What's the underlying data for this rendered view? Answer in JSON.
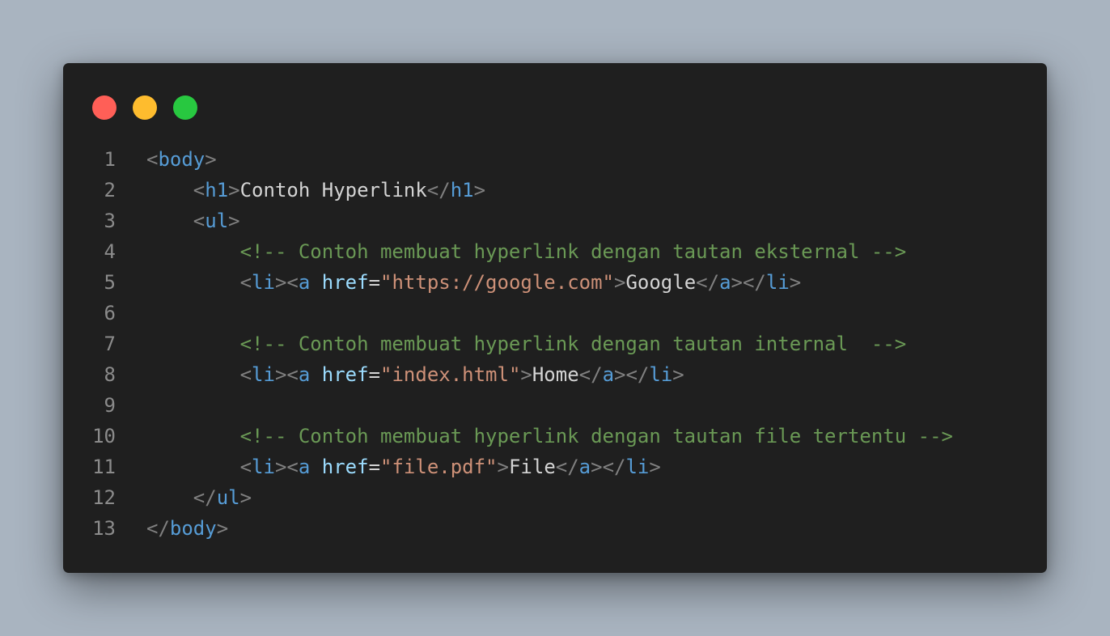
{
  "window": {
    "controls": [
      {
        "name": "close-button",
        "color": "#ff5f57"
      },
      {
        "name": "minimize-button",
        "color": "#febc2e"
      },
      {
        "name": "maximize-button",
        "color": "#28c840"
      }
    ]
  },
  "code": {
    "language": "html",
    "lines": [
      {
        "number": "1",
        "indent": 0,
        "tokens": [
          {
            "t": "punct",
            "v": "<"
          },
          {
            "t": "tag",
            "v": "body"
          },
          {
            "t": "punct",
            "v": ">"
          }
        ]
      },
      {
        "number": "2",
        "indent": 4,
        "tokens": [
          {
            "t": "punct",
            "v": "<"
          },
          {
            "t": "tag",
            "v": "h1"
          },
          {
            "t": "punct",
            "v": ">"
          },
          {
            "t": "text",
            "v": "Contoh Hyperlink"
          },
          {
            "t": "punct",
            "v": "</"
          },
          {
            "t": "tag",
            "v": "h1"
          },
          {
            "t": "punct",
            "v": ">"
          }
        ]
      },
      {
        "number": "3",
        "indent": 4,
        "tokens": [
          {
            "t": "punct",
            "v": "<"
          },
          {
            "t": "tag",
            "v": "ul"
          },
          {
            "t": "punct",
            "v": ">"
          }
        ]
      },
      {
        "number": "4",
        "indent": 8,
        "tokens": [
          {
            "t": "comment",
            "v": "<!-- Contoh membuat hyperlink dengan tautan eksternal -->"
          }
        ]
      },
      {
        "number": "5",
        "indent": 8,
        "tokens": [
          {
            "t": "punct",
            "v": "<"
          },
          {
            "t": "tag",
            "v": "li"
          },
          {
            "t": "punct",
            "v": ">"
          },
          {
            "t": "punct",
            "v": "<"
          },
          {
            "t": "tag",
            "v": "a"
          },
          {
            "t": "text",
            "v": " "
          },
          {
            "t": "attr",
            "v": "href"
          },
          {
            "t": "eq",
            "v": "="
          },
          {
            "t": "str",
            "v": "\"https://google.com\""
          },
          {
            "t": "punct",
            "v": ">"
          },
          {
            "t": "text",
            "v": "Google"
          },
          {
            "t": "punct",
            "v": "</"
          },
          {
            "t": "tag",
            "v": "a"
          },
          {
            "t": "punct",
            "v": ">"
          },
          {
            "t": "punct",
            "v": "</"
          },
          {
            "t": "tag",
            "v": "li"
          },
          {
            "t": "punct",
            "v": ">"
          }
        ]
      },
      {
        "number": "6",
        "indent": 0,
        "tokens": []
      },
      {
        "number": "7",
        "indent": 8,
        "tokens": [
          {
            "t": "comment",
            "v": "<!-- Contoh membuat hyperlink dengan tautan internal  -->"
          }
        ]
      },
      {
        "number": "8",
        "indent": 8,
        "tokens": [
          {
            "t": "punct",
            "v": "<"
          },
          {
            "t": "tag",
            "v": "li"
          },
          {
            "t": "punct",
            "v": ">"
          },
          {
            "t": "punct",
            "v": "<"
          },
          {
            "t": "tag",
            "v": "a"
          },
          {
            "t": "text",
            "v": " "
          },
          {
            "t": "attr",
            "v": "href"
          },
          {
            "t": "eq",
            "v": "="
          },
          {
            "t": "str",
            "v": "\"index.html\""
          },
          {
            "t": "punct",
            "v": ">"
          },
          {
            "t": "text",
            "v": "Home"
          },
          {
            "t": "punct",
            "v": "</"
          },
          {
            "t": "tag",
            "v": "a"
          },
          {
            "t": "punct",
            "v": ">"
          },
          {
            "t": "punct",
            "v": "</"
          },
          {
            "t": "tag",
            "v": "li"
          },
          {
            "t": "punct",
            "v": ">"
          }
        ]
      },
      {
        "number": "9",
        "indent": 0,
        "tokens": []
      },
      {
        "number": "10",
        "indent": 8,
        "tokens": [
          {
            "t": "comment",
            "v": "<!-- Contoh membuat hyperlink dengan tautan file tertentu -->"
          }
        ]
      },
      {
        "number": "11",
        "indent": 8,
        "tokens": [
          {
            "t": "punct",
            "v": "<"
          },
          {
            "t": "tag",
            "v": "li"
          },
          {
            "t": "punct",
            "v": ">"
          },
          {
            "t": "punct",
            "v": "<"
          },
          {
            "t": "tag",
            "v": "a"
          },
          {
            "t": "text",
            "v": " "
          },
          {
            "t": "attr",
            "v": "href"
          },
          {
            "t": "eq",
            "v": "="
          },
          {
            "t": "str",
            "v": "\"file.pdf\""
          },
          {
            "t": "punct",
            "v": ">"
          },
          {
            "t": "text",
            "v": "File"
          },
          {
            "t": "punct",
            "v": "</"
          },
          {
            "t": "tag",
            "v": "a"
          },
          {
            "t": "punct",
            "v": ">"
          },
          {
            "t": "punct",
            "v": "</"
          },
          {
            "t": "tag",
            "v": "li"
          },
          {
            "t": "punct",
            "v": ">"
          }
        ]
      },
      {
        "number": "12",
        "indent": 4,
        "tokens": [
          {
            "t": "punct",
            "v": "</"
          },
          {
            "t": "tag",
            "v": "ul"
          },
          {
            "t": "punct",
            "v": ">"
          }
        ]
      },
      {
        "number": "13",
        "indent": 0,
        "tokens": [
          {
            "t": "punct",
            "v": "</"
          },
          {
            "t": "tag",
            "v": "body"
          },
          {
            "t": "punct",
            "v": ">"
          }
        ]
      }
    ]
  }
}
